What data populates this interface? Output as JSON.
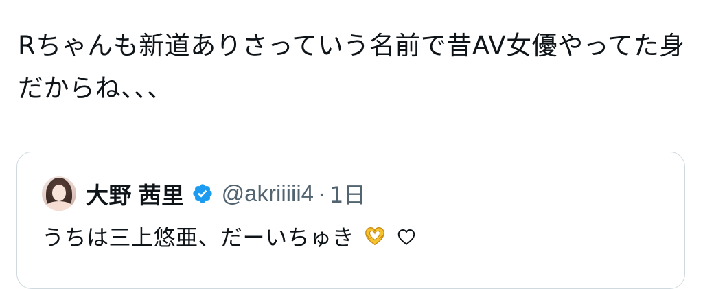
{
  "tweet": {
    "text": "Rちゃんも新道ありさっていう名前で昔AV女優やってた身だからね、、、"
  },
  "quoted_tweet": {
    "display_name": "大野 茜里",
    "handle": "@akriiiii4",
    "separator": "·",
    "time": "1日",
    "text": "うちは三上悠亜、だーいちゅき",
    "verified": true,
    "verified_color": "#1d9bf0",
    "emojis": [
      "heart-hands-icon",
      "white-heart-icon"
    ]
  },
  "colors": {
    "text_primary": "#0f1419",
    "text_secondary": "#536471",
    "card_border": "#cfd9de"
  }
}
